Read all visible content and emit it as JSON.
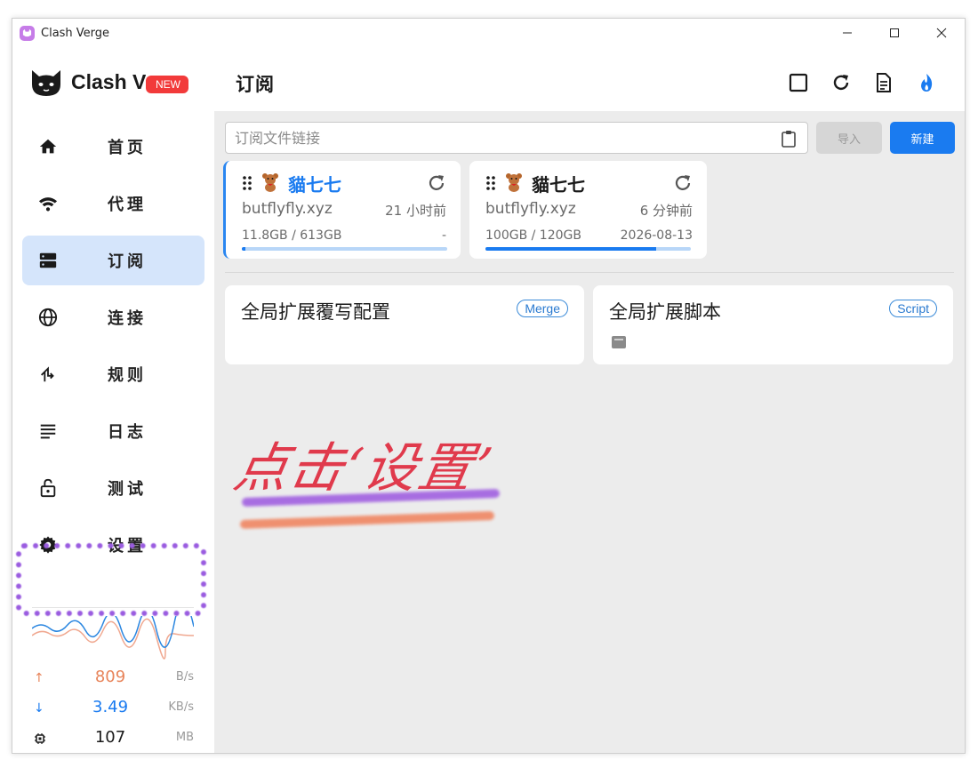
{
  "window": {
    "title": "Clash Verge"
  },
  "sidebar": {
    "logo_text": "Clash Verge",
    "new_badge": "NEW",
    "items": [
      {
        "label": "首页",
        "icon": "home-icon"
      },
      {
        "label": "代理",
        "icon": "wifi-icon"
      },
      {
        "label": "订阅",
        "icon": "server-icon",
        "active": true
      },
      {
        "label": "连接",
        "icon": "globe-icon"
      },
      {
        "label": "规则",
        "icon": "fork-icon"
      },
      {
        "label": "日志",
        "icon": "lines-icon"
      },
      {
        "label": "测试",
        "icon": "lock-icon"
      },
      {
        "label": "设置",
        "icon": "gear-icon"
      }
    ],
    "stats": {
      "upload": {
        "value": "809",
        "unit": "B/s",
        "color": "#e8845a"
      },
      "download": {
        "value": "3.49",
        "unit": "KB/s",
        "color": "#1a7bf0"
      },
      "memory": {
        "value": "107",
        "unit": "MB"
      }
    }
  },
  "main": {
    "title": "订阅",
    "input_placeholder": "订阅文件链接",
    "import_label": "导入",
    "new_label": "新建",
    "profiles": [
      {
        "name": "貓七七",
        "host": "butflyfly.xyz",
        "updated": "21 小时前",
        "usage": "11.8GB / 613GB",
        "expire": "-",
        "used_fraction": 0.019,
        "selected": true
      },
      {
        "name": "貓七七",
        "host": "butflyfly.xyz",
        "updated": "6 分钟前",
        "usage": "100GB / 120GB",
        "expire": "2026-08-13",
        "used_fraction": 0.83,
        "selected": false
      }
    ],
    "extensions": [
      {
        "title": "全局扩展覆写配置",
        "badge": "Merge"
      },
      {
        "title": "全局扩展脚本",
        "badge": "Script"
      }
    ],
    "annotation": "点击‘设置’"
  },
  "colors": {
    "accent": "#1a7bf0",
    "active_nav": "#d5e5fb",
    "annotation": "#e03a4c"
  }
}
